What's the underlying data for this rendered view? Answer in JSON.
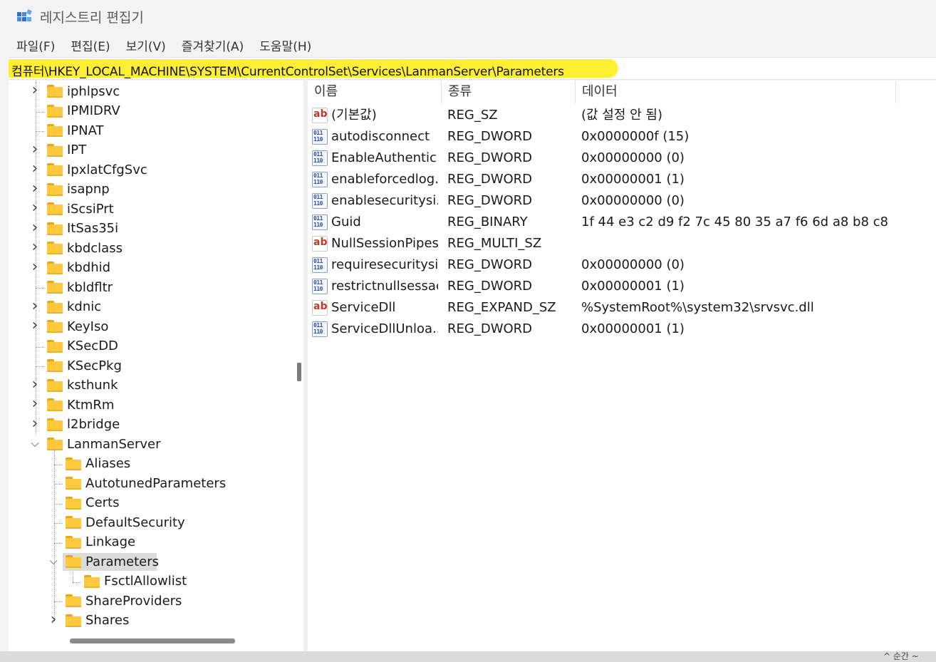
{
  "window": {
    "title": "레지스트리 편집기"
  },
  "menu": [
    "파일(F)",
    "편집(E)",
    "보기(V)",
    "즐겨찾기(A)",
    "도움말(H)"
  ],
  "address": "컴퓨터\\HKEY_LOCAL_MACHINE\\SYSTEM\\CurrentControlSet\\Services\\LanmanServer\\Parameters",
  "highlight_color": "#ffee33",
  "tree": {
    "items": [
      {
        "label": "iphlpsvc",
        "expander": "collapsed"
      },
      {
        "label": "IPMIDRV",
        "expander": "none"
      },
      {
        "label": "IPNAT",
        "expander": "none"
      },
      {
        "label": "IPT",
        "expander": "collapsed"
      },
      {
        "label": "IpxlatCfgSvc",
        "expander": "collapsed"
      },
      {
        "label": "isapnp",
        "expander": "collapsed"
      },
      {
        "label": "iScsiPrt",
        "expander": "collapsed"
      },
      {
        "label": "ItSas35i",
        "expander": "collapsed"
      },
      {
        "label": "kbdclass",
        "expander": "collapsed"
      },
      {
        "label": "kbdhid",
        "expander": "collapsed"
      },
      {
        "label": "kbldfltr",
        "expander": "none"
      },
      {
        "label": "kdnic",
        "expander": "collapsed"
      },
      {
        "label": "KeyIso",
        "expander": "collapsed"
      },
      {
        "label": "KSecDD",
        "expander": "none"
      },
      {
        "label": "KSecPkg",
        "expander": "none"
      },
      {
        "label": "ksthunk",
        "expander": "collapsed"
      },
      {
        "label": "KtmRm",
        "expander": "collapsed"
      },
      {
        "label": "l2bridge",
        "expander": "collapsed"
      },
      {
        "label": "LanmanServer",
        "expander": "expanded"
      },
      {
        "label": "Aliases",
        "expander": "none"
      },
      {
        "label": "AutotunedParameters",
        "expander": "none"
      },
      {
        "label": "Certs",
        "expander": "none"
      },
      {
        "label": "DefaultSecurity",
        "expander": "none"
      },
      {
        "label": "Linkage",
        "expander": "none"
      },
      {
        "label": "Parameters",
        "expander": "expanded"
      },
      {
        "label": "FsctlAllowlist",
        "expander": "none"
      },
      {
        "label": "ShareProviders",
        "expander": "none"
      },
      {
        "label": "Shares",
        "expander": "collapsed"
      }
    ]
  },
  "list": {
    "columns": [
      "이름",
      "종류",
      "데이터"
    ],
    "rows": [
      {
        "icon": "string-value-icon",
        "name": "(기본값)",
        "type": "REG_SZ",
        "data": "(값 설정 안 됨)"
      },
      {
        "icon": "binary-value-icon",
        "name": "autodisconnect",
        "type": "REG_DWORD",
        "data": "0x0000000f (15)"
      },
      {
        "icon": "binary-value-icon",
        "name": "EnableAuthentic...",
        "type": "REG_DWORD",
        "data": "0x00000000 (0)"
      },
      {
        "icon": "binary-value-icon",
        "name": "enableforcedlog...",
        "type": "REG_DWORD",
        "data": "0x00000001 (1)"
      },
      {
        "icon": "binary-value-icon",
        "name": "enablesecuritysi...",
        "type": "REG_DWORD",
        "data": "0x00000000 (0)"
      },
      {
        "icon": "binary-value-icon",
        "name": "Guid",
        "type": "REG_BINARY",
        "data": "1f 44 e3 c2 d9 f2 7c 45 80 35 a7 f6 6d a8 b8 c8"
      },
      {
        "icon": "string-value-icon",
        "name": "NullSessionPipes",
        "type": "REG_MULTI_SZ",
        "data": ""
      },
      {
        "icon": "binary-value-icon",
        "name": "requiresecuritysi...",
        "type": "REG_DWORD",
        "data": "0x00000000 (0)"
      },
      {
        "icon": "binary-value-icon",
        "name": "restrictnullsessac...",
        "type": "REG_DWORD",
        "data": "0x00000001 (1)"
      },
      {
        "icon": "string-value-icon",
        "name": "ServiceDll",
        "type": "REG_EXPAND_SZ",
        "data": "%SystemRoot%\\system32\\srvsvc.dll"
      },
      {
        "icon": "binary-value-icon",
        "name": "ServiceDllUnloa...",
        "type": "REG_DWORD",
        "data": "0x00000001 (1)"
      }
    ]
  },
  "icon_glyphs": {
    "string": "ab",
    "binary": "011\n110"
  },
  "bottom_fragment": "^ 순간 ~"
}
